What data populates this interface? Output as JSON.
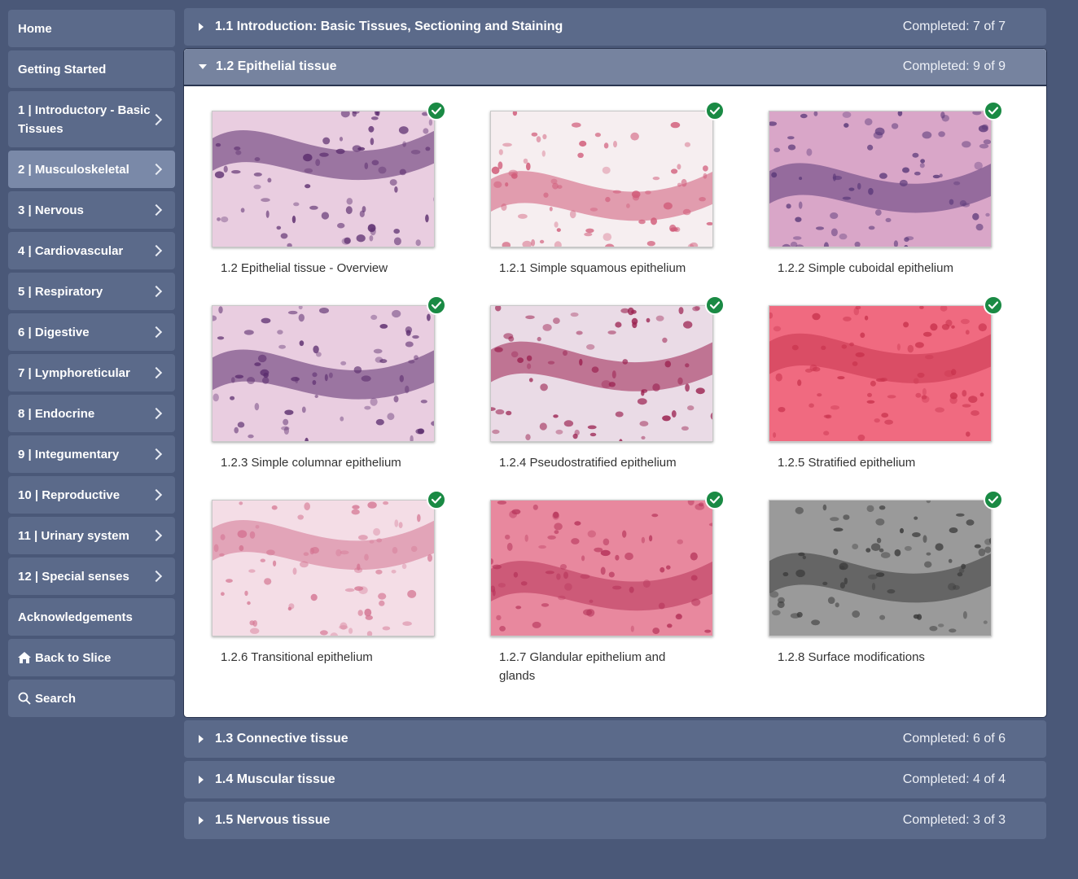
{
  "sidebar": {
    "items": [
      {
        "label": "Home",
        "chevron": false
      },
      {
        "label": "Getting Started",
        "chevron": false
      },
      {
        "label": "1 | Introductory - Basic Tissues",
        "chevron": true
      },
      {
        "label": "2 | Musculoskeletal",
        "chevron": true,
        "active": true
      },
      {
        "label": "3 | Nervous",
        "chevron": true
      },
      {
        "label": "4 | Cardiovascular",
        "chevron": true
      },
      {
        "label": "5 | Respiratory",
        "chevron": true
      },
      {
        "label": "6 | Digestive",
        "chevron": true
      },
      {
        "label": "7 | Lymphoreticular",
        "chevron": true
      },
      {
        "label": "8 | Endocrine",
        "chevron": true
      },
      {
        "label": "9 | Integumentary",
        "chevron": true
      },
      {
        "label": "10 | Reproductive",
        "chevron": true
      },
      {
        "label": "11 | Urinary system",
        "chevron": true
      },
      {
        "label": "12 | Special senses",
        "chevron": true
      },
      {
        "label": "Acknowledgements",
        "chevron": false
      },
      {
        "label": "Back to Slice",
        "chevron": false,
        "icon": "home-icon"
      },
      {
        "label": "Search",
        "chevron": false,
        "icon": "search-icon"
      }
    ]
  },
  "sections": [
    {
      "title": "1.1 Introduction: Basic Tissues, Sectioning and Staining",
      "completed": "Completed: 7 of 7",
      "open": false
    },
    {
      "title": "1.2 Epithelial tissue",
      "completed": "Completed: 9 of 9",
      "open": true
    },
    {
      "title": "1.3 Connective tissue",
      "completed": "Completed: 6 of 6",
      "open": false
    },
    {
      "title": "1.4 Muscular tissue",
      "completed": "Completed: 4 of 4",
      "open": false
    },
    {
      "title": "1.5 Nervous tissue",
      "completed": "Completed: 3 of 3",
      "open": false
    }
  ],
  "cards": [
    {
      "label": "1.2 Epithelial tissue - Overview",
      "bg": "#e9cde0",
      "accent": "#5b2d6e",
      "done": true
    },
    {
      "label": "1.2.1 Simple squamous epithelium",
      "bg": "#f6eef0",
      "accent": "#d05a78",
      "done": true
    },
    {
      "label": "1.2.2 Simple cuboidal epithelium",
      "bg": "#d9a6c8",
      "accent": "#5c3a7a",
      "done": true
    },
    {
      "label": "1.2.3 Simple columnar epithelium",
      "bg": "#e9cde0",
      "accent": "#5b2d6e",
      "done": true
    },
    {
      "label": "1.2.4 Pseudostratified epithelium",
      "bg": "#eadbe6",
      "accent": "#9a1f4e",
      "done": true
    },
    {
      "label": "1.2.5 Stratified epithelium",
      "bg": "#f06a80",
      "accent": "#c9344e",
      "done": true
    },
    {
      "label": "1.2.6 Transitional epithelium",
      "bg": "#f4dde6",
      "accent": "#d47592",
      "done": true
    },
    {
      "label": "1.2.7 Glandular epithelium and glands",
      "bg": "#e8889e",
      "accent": "#b6345a",
      "done": true
    },
    {
      "label": "1.2.8 Surface modifications",
      "bg": "#9a9a9a",
      "accent": "#3a3a3a",
      "done": true
    }
  ]
}
